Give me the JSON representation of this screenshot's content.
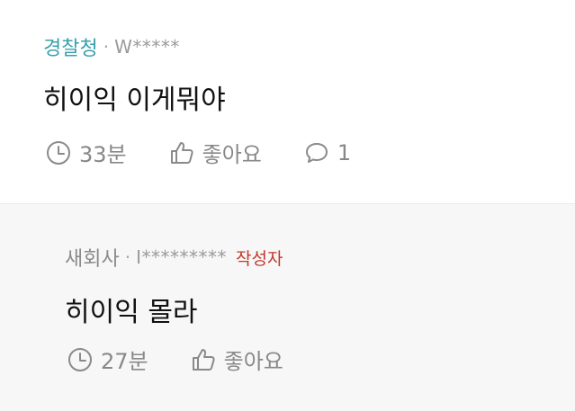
{
  "comments": [
    {
      "author_prefix": "경찰청",
      "author_id": "W*****",
      "badge": "",
      "text": "히이익 이게뭐야",
      "time": "33분",
      "like_label": "좋아요",
      "reply_count": "1"
    },
    {
      "author_prefix": "새회사",
      "author_id": "I*********",
      "badge": "작성자",
      "text": "히이익 몰라",
      "time": "27분",
      "like_label": "좋아요"
    }
  ],
  "separator": "·",
  "colors": {
    "accent": "#3aa0ad",
    "badge": "#c0392b",
    "muted": "#888888",
    "reply_bg": "#f7f7f7"
  },
  "icons": {
    "time": "clock-icon",
    "like": "thumbs-up-icon",
    "reply": "speech-bubble-icon"
  }
}
